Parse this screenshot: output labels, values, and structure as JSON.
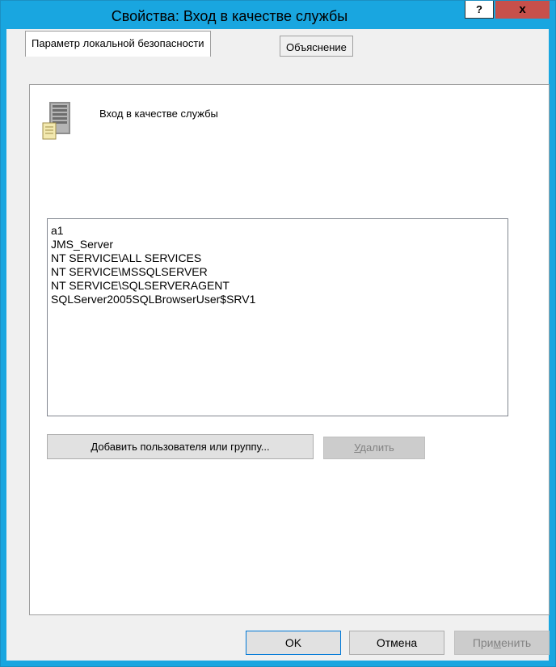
{
  "window": {
    "title": "Свойства: Вход в качестве службы",
    "help_label": "?",
    "close_label": "x"
  },
  "tabs": [
    {
      "label": "Параметр локальной безопасности",
      "active": true
    },
    {
      "label": "Объяснение",
      "active": false
    }
  ],
  "policy": {
    "name": "Вход в качестве службы",
    "icon": "server-icon"
  },
  "accounts": [
    "a1",
    "JMS_Server",
    "NT SERVICE\\ALL SERVICES",
    "NT SERVICE\\MSSQLSERVER",
    "NT SERVICE\\SQLSERVERAGENT",
    "SQLServer2005SQLBrowserUser$SRV1"
  ],
  "actions": {
    "add_prefix": "Д",
    "add_rest": "обавить пользователя или группу...",
    "remove_prefix": "У",
    "remove_rest": "далить"
  },
  "footer": {
    "ok_label": "OK",
    "cancel_label": "Отмена",
    "apply_prefix": "При",
    "apply_underline": "м",
    "apply_rest": "енить"
  },
  "colors": {
    "frame": "#19a6e0",
    "close": "#c7504b",
    "dialog_bg": "#f0f0f0"
  }
}
